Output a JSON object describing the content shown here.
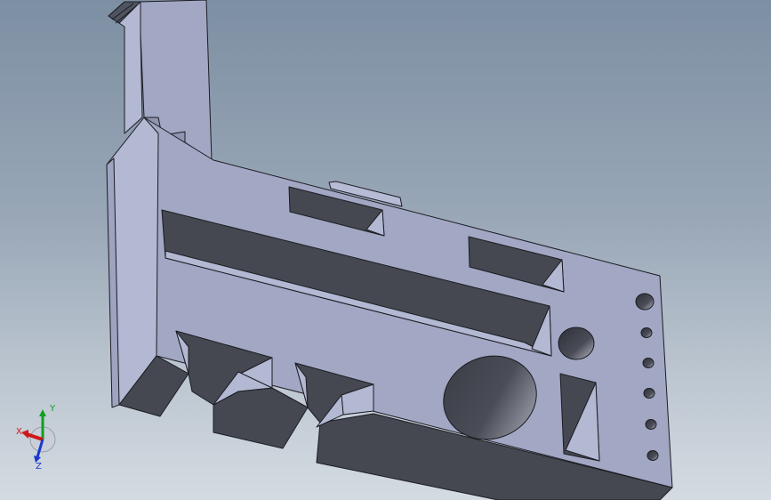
{
  "viewport": {
    "background_top": "#7d8fa3",
    "background_bottom": "#d4dbe2"
  },
  "model": {
    "face_light": "#a2a7c4",
    "face_mid": "#9196b4",
    "face_side": "#b3b8d3",
    "cavity": "#454850",
    "edge": "#1c1c22"
  },
  "triad": {
    "x_label": "X",
    "y_label": "Y",
    "z_label": "Z",
    "x_color": "#d01818",
    "y_color": "#10a020",
    "z_color": "#1838d0"
  }
}
